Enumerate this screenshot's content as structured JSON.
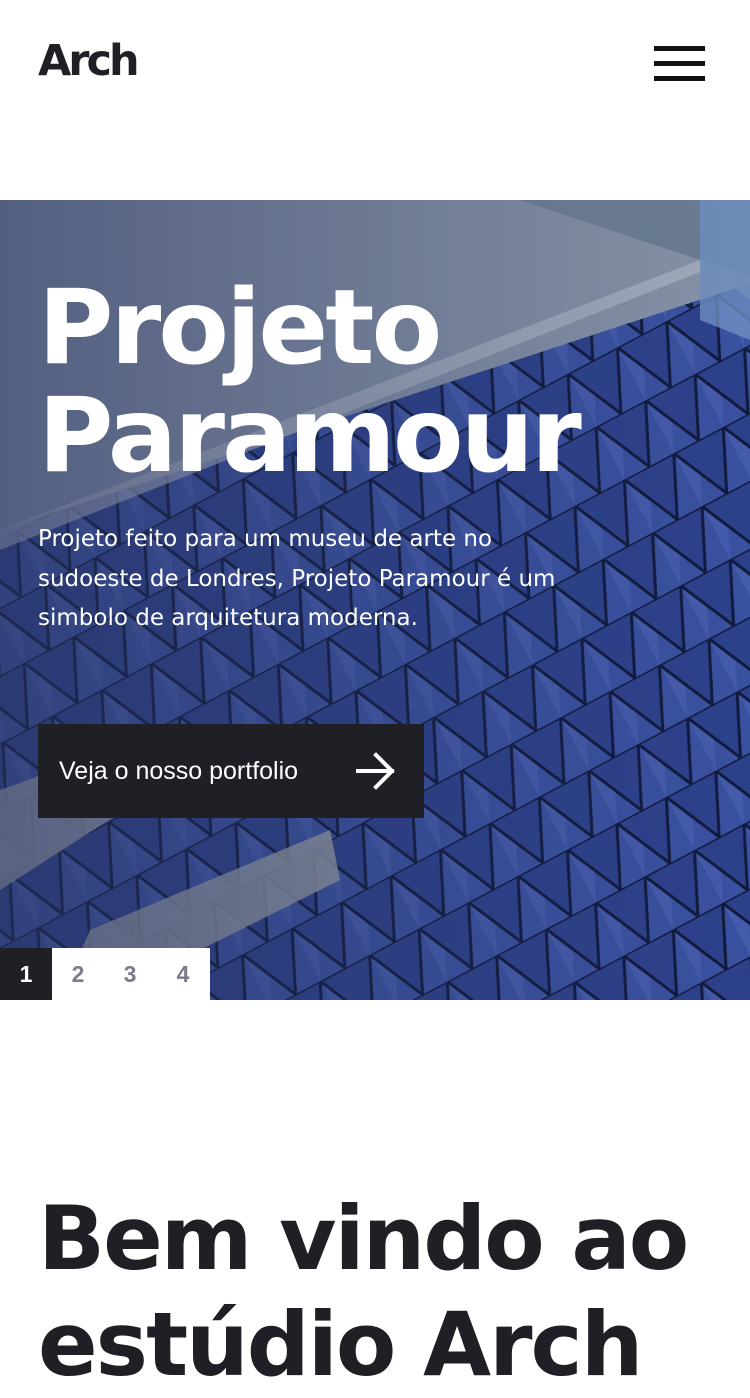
{
  "header": {
    "logo": "Arch",
    "menu_icon": "hamburger-menu-icon"
  },
  "hero": {
    "title_line1": "Projeto",
    "title_line2": "Paramour",
    "description": "Projeto feito para um museu de arte no sudoeste de Londres, Projeto Paramour é um simbolo de arquitetura moderna.",
    "button_label": "Veja o nosso portfolio",
    "button_icon": "arrow-right-icon",
    "background_image": "building-glass-facade"
  },
  "pagination": {
    "pages": [
      "1",
      "2",
      "3",
      "4"
    ],
    "active": "1"
  },
  "welcome": {
    "line1": "Bem vindo ao",
    "line2": "estúdio Arch"
  },
  "colors": {
    "dark": "#1f2025",
    "white": "#ffffff",
    "muted": "#7a7c8a",
    "hero_blue": "#2c4591"
  }
}
